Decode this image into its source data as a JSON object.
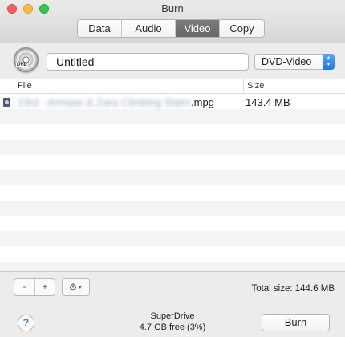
{
  "window": {
    "title": "Burn"
  },
  "tabs": [
    {
      "label": "Data"
    },
    {
      "label": "Audio"
    },
    {
      "label": "Video",
      "active": true
    },
    {
      "label": "Copy"
    }
  ],
  "disc": {
    "icon": "dvd-disc-icon",
    "badge": "DVD"
  },
  "name_field": {
    "value": "Untitled"
  },
  "format_select": {
    "selected": "DVD-Video"
  },
  "list": {
    "columns": {
      "file": "File",
      "size": "Size"
    },
    "rows": [
      {
        "name_hidden": "23rd - Armaan & Zara Climbing Stairs",
        "ext": ".mpg",
        "size": "143.4 MB"
      }
    ]
  },
  "footer": {
    "remove_label": "-",
    "add_label": "+",
    "gear_icon": "gear-icon",
    "total": "Total size: 144.6 MB",
    "help_label": "?",
    "drive_name": "SuperDrive",
    "drive_free": "4.7 GB free (3%)",
    "burn_label": "Burn"
  },
  "colors": {
    "accent": "#1c78f1",
    "active_tab": "#6e6e6e"
  }
}
